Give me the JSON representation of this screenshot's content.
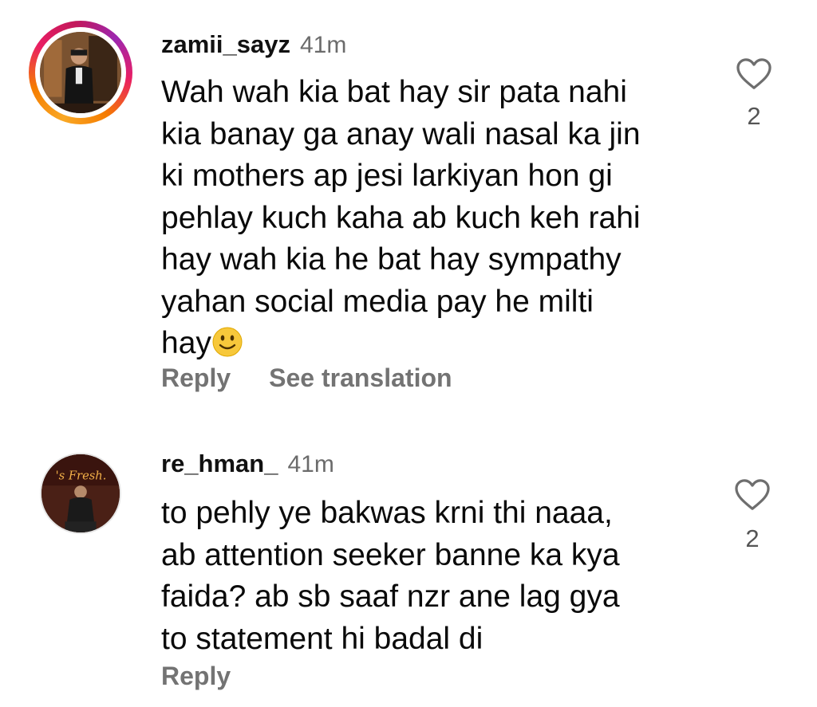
{
  "comments": [
    {
      "username": "zamii_sayz",
      "time": "41m",
      "text": "Wah wah kia bat hay sir pata nahi\nkia banay ga anay wali nasal ka jin\nki mothers ap jesi larkiyan hon gi\npehlay kuch kaha ab kuch keh rahi\nhay wah kia he bat hay sympathy\nyahan social media pay he milti\nhay",
      "emoji": "slightly-smiling-face",
      "likes": "2",
      "actions": [
        "Reply",
        "See translation"
      ]
    },
    {
      "username": "re_hman_",
      "time": "41m",
      "text": "to pehly ye bakwas krni thi naaa,\nab attention seeker banne ka kya\nfaida? ab sb saaf nzr ane lag gya\nto statement hi badal di",
      "likes": "2",
      "actions": [
        "Reply"
      ]
    }
  ],
  "avatar_text": "'s Fresh.",
  "icons": {
    "like": "heart-outline-icon"
  },
  "colors": {
    "story_ring": "#e91e63",
    "secondary_text": "#737373"
  }
}
